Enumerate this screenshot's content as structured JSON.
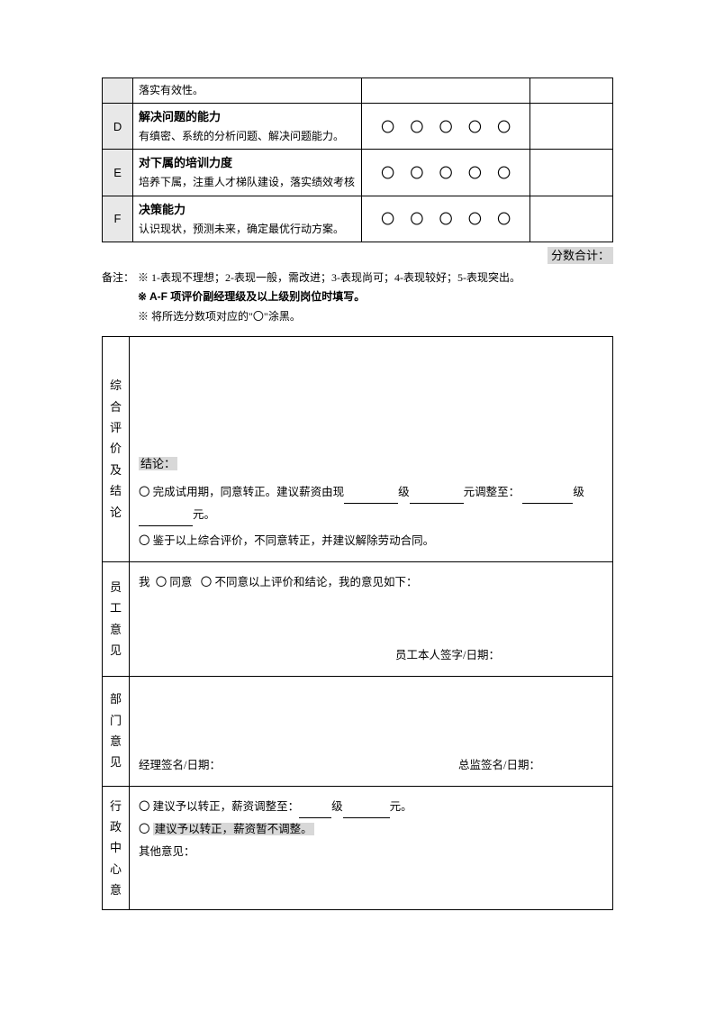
{
  "rating_items": [
    {
      "letter": "",
      "title": "",
      "desc": "落实有效性。",
      "show_circles": false,
      "show_title": false
    },
    {
      "letter": "D",
      "title": "解决问题的能力",
      "desc": "有缜密、系统的分析问题、解决问题能力。",
      "show_circles": true,
      "show_title": true
    },
    {
      "letter": "E",
      "title": "对下属的培训力度",
      "desc": "培养下属，注重人才梯队建设，落实绩效考核",
      "show_circles": true,
      "show_title": true
    },
    {
      "letter": "F",
      "title": "决策能力",
      "desc": "认识现状，预测未来，确定最优行动方案。",
      "show_circles": true,
      "show_title": true
    }
  ],
  "score_total_label": "分数合计：",
  "notes": {
    "label": "备注：",
    "line1": "※ 1-表现不理想；2-表现一般，需改进；3-表现尚可；4-表现较好；5-表现突出。",
    "line2": "※ A-F 项评价副经理级及以上级别岗位时填写。",
    "line3_a": "※ 将所选分数项对应的\"",
    "line3_b": "〇",
    "line3_c": "\"涂黑。"
  },
  "eval": {
    "comprehensive_label": "综合评价及结论",
    "conclusion_label": "结论：",
    "opt_sym": "〇",
    "opt1_a": "完成试用期，同意转正。建议薪资由现",
    "opt1_b": "级",
    "opt1_c": "元调整至：",
    "opt1_d": "级",
    "opt1_e": "元。",
    "opt2": "鉴于以上综合评价，不同意转正，并建议解除劳动合同。"
  },
  "employee": {
    "label": "员工意见",
    "prefix": "我",
    "agree": "同意",
    "disagree": "不同意以上评价和结论，我的意见如下：",
    "sig": "员工本人签字/日期："
  },
  "dept": {
    "label": "部门意见",
    "mgr_sig": "经理签名/日期：",
    "dir_sig": "总监签名/日期："
  },
  "admin": {
    "label": "行政中心意",
    "opt1_a": "建议予以转正，薪资调整至：",
    "opt1_b": "级",
    "opt1_c": "元。",
    "opt2": "建议予以转正，薪资暂不调整。",
    "other": "其他意见："
  }
}
